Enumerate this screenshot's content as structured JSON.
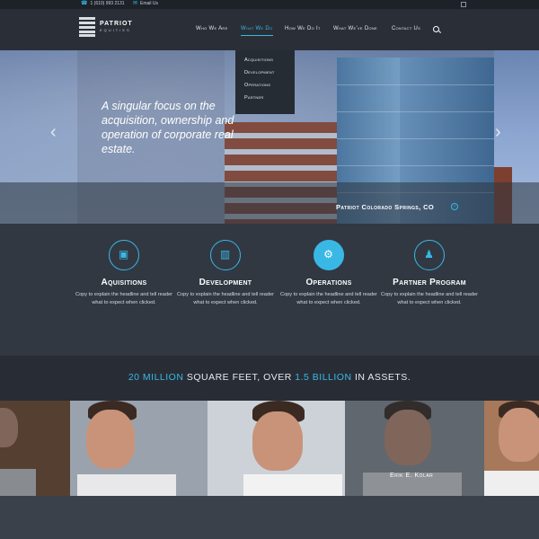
{
  "topbar": {
    "phone": "1 (610) 993 2131",
    "email": "Email Us"
  },
  "logo": {
    "name": "PATRIOT",
    "sub": "EQUITIES"
  },
  "nav": {
    "items": [
      {
        "label": "Who We Are"
      },
      {
        "label": "What We Do",
        "active": true
      },
      {
        "label": "How We Do It"
      },
      {
        "label": "What We've Done"
      },
      {
        "label": "Contact Us"
      }
    ]
  },
  "dropdown": {
    "items": [
      "Acquisitions",
      "Development",
      "Operations",
      "Partner"
    ]
  },
  "hero": {
    "tagline": "A singular focus on the acquisition, ownership and operation of corporate real estate.",
    "caption": "Patriot Colorado Springs, CO"
  },
  "services": [
    {
      "title": "Aquisitions",
      "desc": "Copy to explain the headline and tell reader what to expect when clicked.",
      "icon": "money-icon"
    },
    {
      "title": "Development",
      "desc": "Copy to explain the headline and tell reader what to expect when clicked.",
      "icon": "building-icon"
    },
    {
      "title": "Operations",
      "desc": "Copy to explain the headline and tell reader what to expect when clicked.",
      "icon": "gears-icon"
    },
    {
      "title": "Partner Program",
      "desc": "Copy to explain the headline and tell reader what to expect when clicked.",
      "icon": "people-icon"
    }
  ],
  "stats": {
    "part1": "20 MILLION",
    "part2": " SQUARE FEET, OVER ",
    "part3": "1.5 BILLION",
    "part4": " IN ASSETS."
  },
  "people": {
    "featured_name": "Erik E. Kolar"
  },
  "colors": {
    "accent": "#39b8e6",
    "header": "#2a2f37",
    "services_bg": "#313842"
  }
}
